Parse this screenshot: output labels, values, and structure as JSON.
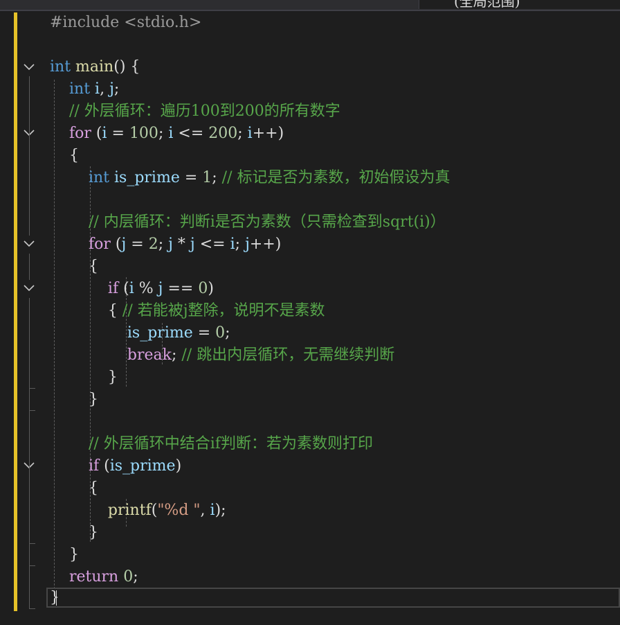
{
  "header": {
    "scope_text": "(全局范围)"
  },
  "colors": {
    "keyword": "#569cd6",
    "control": "#d8a0df",
    "function": "#dcdcaa",
    "variable": "#9cdcfe",
    "number": "#b5cea8",
    "string": "#d69d85",
    "comment": "#57a64a",
    "preprocessor": "#9b9b9b",
    "change_bar": "#e6c229",
    "background": "#1e1e1e"
  },
  "icons": {
    "fold": "chevron-down-icon"
  },
  "code": {
    "l1": {
      "pp": "#include <stdio.h>"
    },
    "l3": {
      "kw": "int",
      "fn": "main",
      "p": "() {"
    },
    "l4": {
      "kw": "int",
      "var1": "i",
      "p1": ", ",
      "var2": "j",
      "p2": ";"
    },
    "l5": {
      "cmt": "// 外层循环：遍历100到200的所有数字"
    },
    "l6": {
      "ctl": "for",
      "p1": " (",
      "v1": "i",
      "p2": " = ",
      "n1": "100",
      "p3": "; ",
      "v2": "i",
      "p4": " <= ",
      "n2": "200",
      "p5": "; ",
      "v3": "i",
      "p6": "++)"
    },
    "l7": {
      "p": "{"
    },
    "l8": {
      "kw": "int",
      "var": "is_prime",
      "p1": " = ",
      "num": "1",
      "p2": "; ",
      "cmt": "// 标记是否为素数，初始假设为真"
    },
    "l10": {
      "cmt": "// 内层循环：判断i是否为素数（只需检查到sqrt(i)）"
    },
    "l11": {
      "ctl": "for",
      "p1": " (",
      "v1": "j",
      "p2": " = ",
      "n1": "2",
      "p3": "; ",
      "v2": "j",
      "p4": " * ",
      "v3": "j",
      "p5": " <= ",
      "v4": "i",
      "p6": "; ",
      "v5": "j",
      "p7": "++)"
    },
    "l12": {
      "p": "{"
    },
    "l13": {
      "ctl": "if",
      "p1": " (",
      "v1": "i",
      "p2": " % ",
      "v2": "j",
      "p3": " == ",
      "n1": "0",
      "p4": ")"
    },
    "l14": {
      "p": "{ ",
      "cmt": "// 若能被j整除，说明不是素数"
    },
    "l15": {
      "var": "is_prime",
      "p1": " = ",
      "num": "0",
      "p2": ";"
    },
    "l16": {
      "ctl": "break",
      "p": "; ",
      "cmt": "// 跳出内层循环，无需继续判断"
    },
    "l17": {
      "p": "}"
    },
    "l18": {
      "p": "}"
    },
    "l20": {
      "cmt": "// 外层循环中结合if判断：若为素数则打印"
    },
    "l21": {
      "ctl": "if",
      "p1": " (",
      "var": "is_prime",
      "p2": ")"
    },
    "l22": {
      "p": "{"
    },
    "l23": {
      "fn": "printf",
      "p1": "(",
      "str": "\"%d \"",
      "p2": ", ",
      "var": "i",
      "p3": ");"
    },
    "l24": {
      "p": "}"
    },
    "l25": {
      "p": "}"
    },
    "l26": {
      "ctl": "return",
      "p1": " ",
      "num": "0",
      "p2": ";"
    },
    "l27": {
      "p": "}"
    }
  }
}
